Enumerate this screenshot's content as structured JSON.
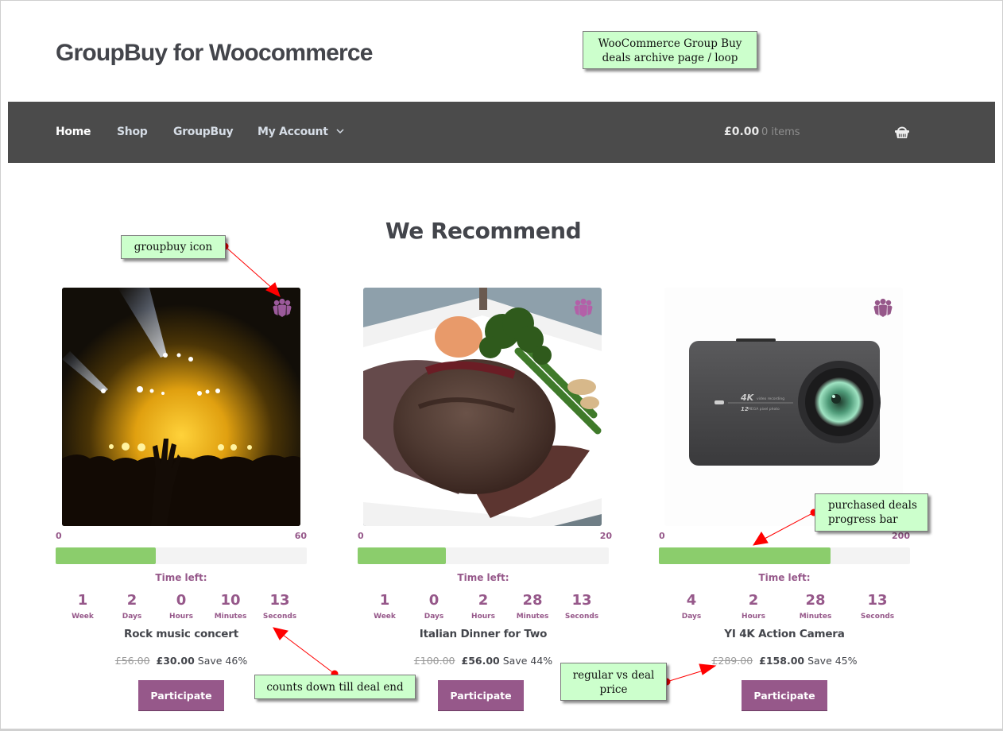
{
  "site": {
    "title": "GroupBuy for Woocommerce"
  },
  "nav": {
    "items": [
      {
        "label": "Home",
        "active": true
      },
      {
        "label": "Shop",
        "active": false
      },
      {
        "label": "GroupBuy",
        "active": false
      },
      {
        "label": "My Account",
        "active": false,
        "has_dropdown": true
      }
    ],
    "cart": {
      "total": "£0.00",
      "count": "0 items",
      "icon": "basket-icon"
    }
  },
  "section": {
    "title": "We Recommend"
  },
  "labels": {
    "time_left": "Time left:",
    "participate": "Participate"
  },
  "colors": {
    "brand_purple": "#96588a",
    "progress_green": "#8bcd6c",
    "nav_bg": "#4b4b4b",
    "annotation_bg": "#ccffcc"
  },
  "products": [
    {
      "title": "Rock music concert",
      "image": "concert-photo",
      "groupbuy_icon": "group-icon",
      "range_min": "0",
      "range_max": "60",
      "purchased": 24,
      "max": 60,
      "countdown": [
        {
          "value": "1",
          "label": "Week"
        },
        {
          "value": "2",
          "label": "Days"
        },
        {
          "value": "0",
          "label": "Hours"
        },
        {
          "value": "10",
          "label": "Minutes"
        },
        {
          "value": "13",
          "label": "Seconds"
        }
      ],
      "regular_price": "£56.00",
      "deal_price": "£30.00",
      "savings": "Save 46%"
    },
    {
      "title": "Italian Dinner for Two",
      "image": "steak-dinner-photo",
      "groupbuy_icon": "group-icon",
      "range_min": "0",
      "range_max": "20",
      "purchased": 7,
      "max": 20,
      "countdown": [
        {
          "value": "1",
          "label": "Week"
        },
        {
          "value": "0",
          "label": "Days"
        },
        {
          "value": "2",
          "label": "Hours"
        },
        {
          "value": "28",
          "label": "Minutes"
        },
        {
          "value": "13",
          "label": "Seconds"
        }
      ],
      "regular_price": "£100.00",
      "deal_price": "£56.00",
      "savings": "Save 44%"
    },
    {
      "title": "YI 4K Action Camera",
      "image": "action-camera-photo",
      "groupbuy_icon": "group-icon",
      "range_min": "0",
      "range_max": "200",
      "purchased": 137,
      "max": 200,
      "countdown": [
        {
          "value": "4",
          "label": "Days"
        },
        {
          "value": "2",
          "label": "Hours"
        },
        {
          "value": "28",
          "label": "Minutes"
        },
        {
          "value": "13",
          "label": "Seconds"
        }
      ],
      "regular_price": "£289.00",
      "deal_price": "£158.00",
      "savings": "Save 45%"
    }
  ],
  "camera_print": {
    "line1_big": "4K",
    "line1_small": "video recording",
    "line2_big": "12",
    "line2_small": "MEGA pixel photo"
  },
  "annotations": [
    {
      "text": "WooCommerce Group Buy deals archive page / loop"
    },
    {
      "text": "groupbuy icon"
    },
    {
      "text": "purchased deals progress bar"
    },
    {
      "text": "counts down till deal end"
    },
    {
      "text": "regular vs deal price"
    }
  ]
}
